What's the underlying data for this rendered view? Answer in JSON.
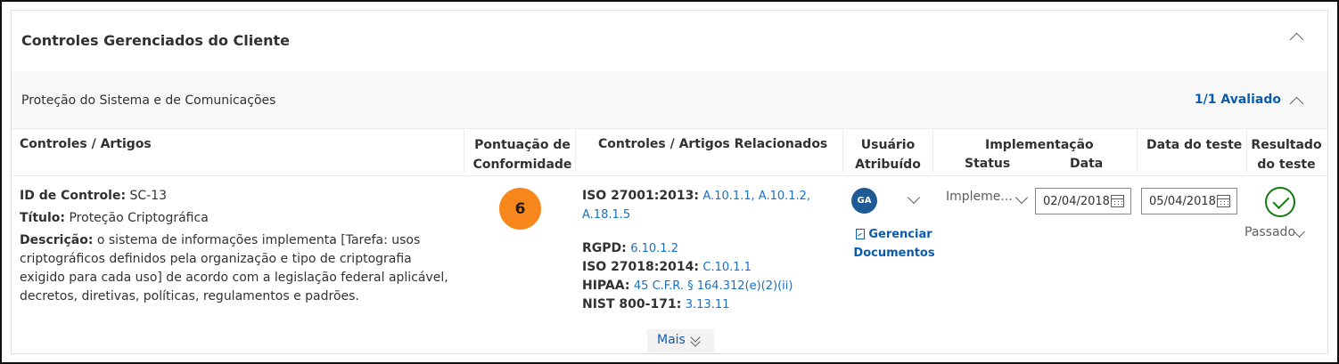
{
  "card": {
    "title": "Controles Gerenciados do Cliente"
  },
  "section": {
    "title": "Proteção do Sistema e de Comunicações",
    "evaluated": "1/1 Avaliado"
  },
  "columns": {
    "controls": "Controles / Artigos",
    "score_line1": "Pontuação de",
    "score_line2": "Conformidade",
    "related": "Controles / Artigos Relacionados",
    "user_line1": "Usuário",
    "user_line2": "Atribuído",
    "impl": "Implementação",
    "impl_status": "Status",
    "impl_date": "Data",
    "test_date": "Data do teste",
    "result_line1": "Resultado",
    "result_line2": "do teste"
  },
  "row": {
    "id_label": "ID de Controle:",
    "id_value": "SC-13",
    "title_label": "Título:",
    "title_value": "Proteção Criptográfica",
    "desc_label": "Descrição:",
    "desc_lines": [
      "o sistema de informações implementa [Tarefa: usos",
      "criptográficos definidos pela organização e tipo de criptografia",
      "exigido para cada uso] de acordo com a legislação federal aplicável,",
      "decretos, diretivas, políticas, regulamentos e padrões."
    ],
    "score": "6",
    "related": [
      {
        "label": "ISO 27001:2013:",
        "links": "A.10.1.1, A.10.1.2, A.18.1.5"
      },
      {
        "label": "RGPD:",
        "links": "6.10.1.2"
      },
      {
        "label": "ISO 27018:2014:",
        "links": "C.10.1.1"
      },
      {
        "label": "HIPAA:",
        "links": "45 C.F.R. § 164.312(e)(2)(ii)"
      },
      {
        "label": "NIST 800-171:",
        "links": "3.13.11"
      }
    ],
    "user_initials": "GA",
    "manage_line1": "Gerenciar",
    "manage_line2": "Documentos",
    "impl_status": "Impleme...",
    "impl_date": "02/04/2018",
    "test_date": "05/04/2018",
    "result": "Passado",
    "more": "Mais"
  },
  "colors": {
    "accent": "#0b5cad",
    "link": "#1a6fc1",
    "score": "#f7861d",
    "pass": "#107c10",
    "avatar": "#1e5b94"
  }
}
